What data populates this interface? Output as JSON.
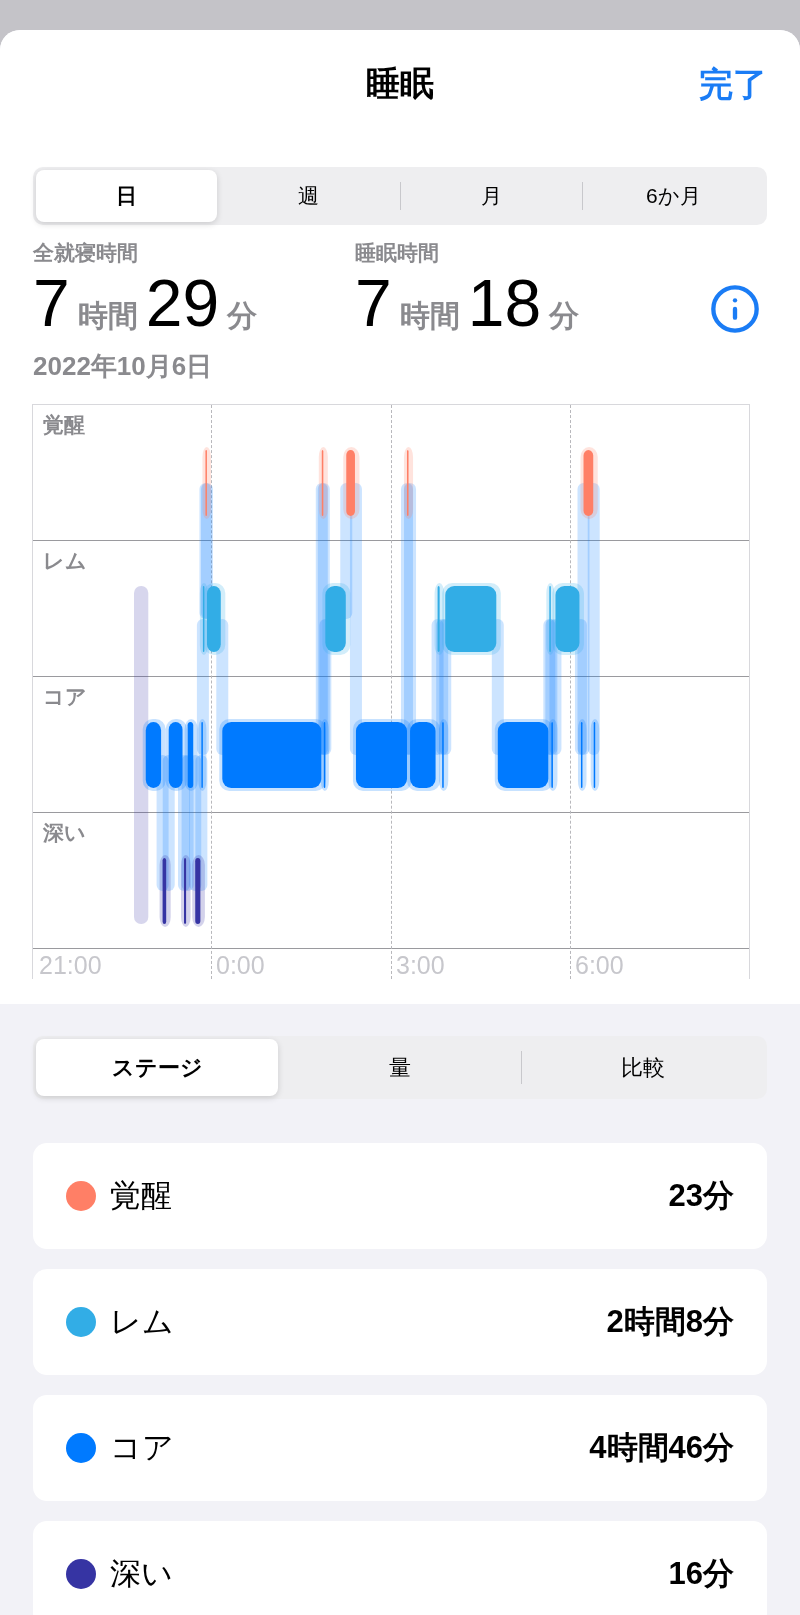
{
  "header": {
    "title": "睡眠",
    "done": "完了"
  },
  "range_tabs": [
    {
      "label": "日",
      "selected": true
    },
    {
      "label": "週",
      "selected": false
    },
    {
      "label": "月",
      "selected": false
    },
    {
      "label": "6か月",
      "selected": false
    }
  ],
  "summary": [
    {
      "label": "全就寝時間",
      "value": [
        {
          "kind": "number",
          "text": "7"
        },
        {
          "kind": "unit",
          "text": "時間"
        },
        {
          "kind": "number",
          "text": "29"
        },
        {
          "kind": "unit",
          "text": "分"
        }
      ]
    },
    {
      "label": "睡眠時間",
      "value": [
        {
          "kind": "number",
          "text": "7"
        },
        {
          "kind": "unit",
          "text": "時間"
        },
        {
          "kind": "number",
          "text": "18"
        },
        {
          "kind": "unit",
          "text": "分"
        }
      ]
    }
  ],
  "date": "2022年10月6日",
  "hypnogram": {
    "stages": [
      "覚醒",
      "レム",
      "コア",
      "深い"
    ],
    "times": [
      "21:00",
      "0:00",
      "3:00",
      "6:00"
    ]
  },
  "view_tabs": [
    {
      "label": "ステージ",
      "selected": true
    },
    {
      "label": "量",
      "selected": false
    },
    {
      "label": "比較",
      "selected": false
    }
  ],
  "stage_list": [
    {
      "name": "覚醒",
      "duration": "23分",
      "color": "#ff7f66"
    },
    {
      "name": "レム",
      "duration": "2時間8分",
      "color": "#32ade6"
    },
    {
      "name": "コア",
      "duration": "4時間46分",
      "color": "#007aff"
    },
    {
      "name": "深い",
      "duration": "16分",
      "color": "#3634a3"
    }
  ]
}
